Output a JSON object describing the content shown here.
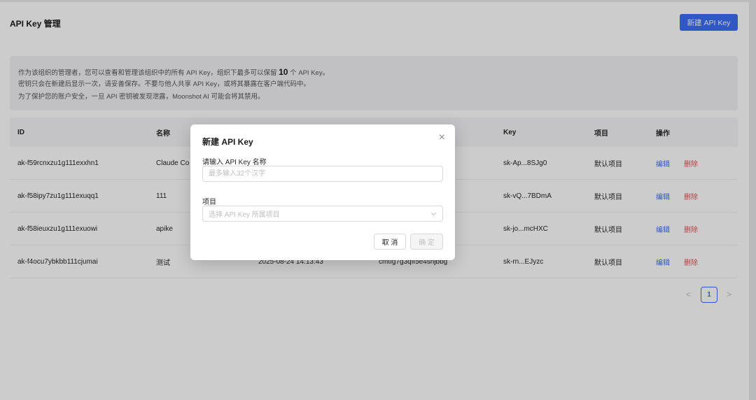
{
  "header": {
    "title": "API Key 管理",
    "new_button": "新建 API Key"
  },
  "notice": {
    "line1_before": "作为该组织的管理者，您可以查看和管理该组织中的所有 API Key，组织下最多可以保留",
    "line1_count": "10",
    "line1_after": "个 API Key。",
    "line2": "密钥只会在新建后显示一次，请妥善保存。不要与他人共享 API Key，或将其暴露在客户端代码中。",
    "line3": "为了保护您的账户安全，一旦 API 密钥被发现泄露，Moonshot AI 可能会将其禁用。"
  },
  "table": {
    "columns": {
      "id": "ID",
      "name": "名称",
      "key": "Key",
      "project": "项目",
      "actions": "操作"
    },
    "rows": [
      {
        "id": "ak-f59rcnxzu1g111exxhn1",
        "name": "Claude Co",
        "time": "",
        "secret": "",
        "key": "sk-Ap...8SJg0",
        "project": "默认项目",
        "edit": "编辑",
        "delete": "删除"
      },
      {
        "id": "ak-f58ipy7zu1g111exuqq1",
        "name": "111",
        "time": "",
        "secret": "",
        "key": "sk-vQ...7BDmA",
        "project": "默认项目",
        "edit": "编辑",
        "delete": "删除"
      },
      {
        "id": "ak-f58ieuxzu1g111exuowi",
        "name": "apike",
        "time": "",
        "secret": "",
        "key": "sk-jo...mcHXC",
        "project": "默认项目",
        "edit": "编辑",
        "delete": "删除"
      },
      {
        "id": "ak-f4ocu7ybkbb111cjumai",
        "name": "测试",
        "time": "2025-08-24 14:13:43",
        "secret": "cmtfg7g3qff5e4shjbbg",
        "key": "sk-rn...EJyzc",
        "project": "默认项目",
        "edit": "编辑",
        "delete": "删除"
      }
    ]
  },
  "pagination": {
    "prev": "<",
    "current": "1",
    "next": ">"
  },
  "modal": {
    "title": "新建 API Key",
    "close": "×",
    "name_label": "请输入 API Key 名称",
    "name_placeholder": "最多输入32个汉字",
    "project_label": "项目",
    "project_placeholder": "选择 API Key 所属项目",
    "cancel": "取 消",
    "confirm": "确 定"
  }
}
